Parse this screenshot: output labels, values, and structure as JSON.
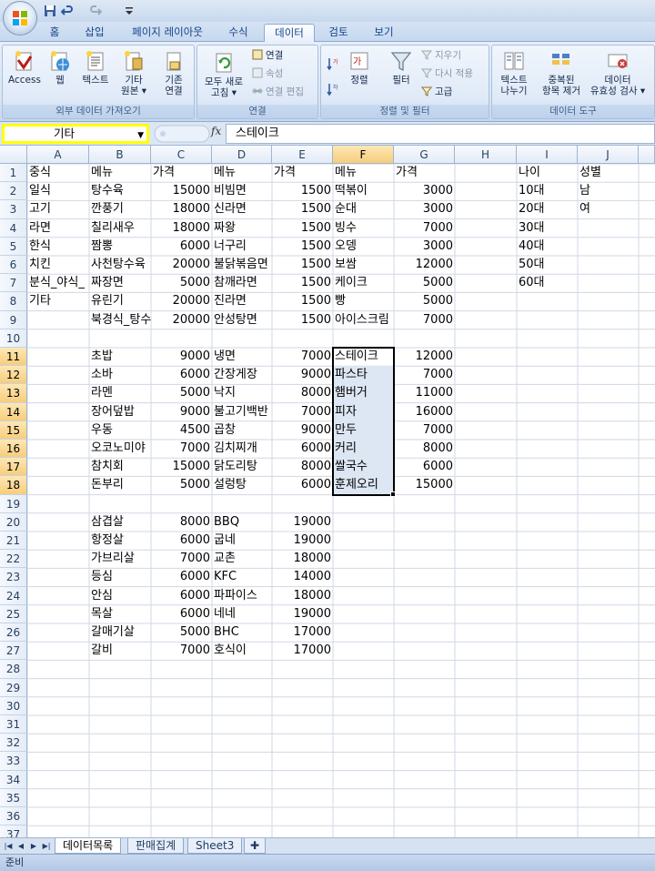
{
  "app": {
    "accent": "#15428b",
    "name_box_highlight": "#ffff00"
  },
  "quick_access": [
    {
      "icon": "save-icon"
    },
    {
      "icon": "undo-icon"
    },
    {
      "icon": "redo-icon"
    },
    {
      "icon": "customize-qat-icon"
    }
  ],
  "ribbon_tabs": [
    "홈",
    "삽입",
    "페이지 레이아웃",
    "수식",
    "데이터",
    "검토",
    "보기"
  ],
  "active_tab": "데이터",
  "ribbon": {
    "external": {
      "label": "외부 데이터 가져오기",
      "access": "Access",
      "web": "웹",
      "text": "텍스트",
      "other_1": "기타",
      "other_2": "원본",
      "existing_1": "기존",
      "existing_2": "연결"
    },
    "connections": {
      "label": "연결",
      "refresh_1": "모두 새로",
      "refresh_2": "고침",
      "connections": "연결",
      "properties": "속성",
      "edit_links": "연결 편집"
    },
    "sort_filter": {
      "label": "정렬 및 필터",
      "sort": "정렬",
      "filter": "필터",
      "clear": "지우기",
      "reapply": "다시 적용",
      "advanced": "고급"
    },
    "data_tools": {
      "label": "데이터 도구",
      "text_to_cols_1": "텍스트",
      "text_to_cols_2": "나누기",
      "remove_dup_1": "중복된",
      "remove_dup_2": "항목 제거",
      "validation_1": "데이터",
      "validation_2": "유효성 검사"
    }
  },
  "formula_bar": {
    "name_box": "기타",
    "fx": "fx",
    "content": "스테이크"
  },
  "grid": {
    "columns": [
      "A",
      "B",
      "C",
      "D",
      "E",
      "F",
      "G",
      "H",
      "I",
      "J"
    ],
    "selected_column": "F",
    "rows": [
      "1",
      "2",
      "3",
      "4",
      "5",
      "6",
      "7",
      "8",
      "9",
      "10",
      "11",
      "12",
      "13",
      "14",
      "15",
      "16",
      "17",
      "18",
      "19",
      "20",
      "21",
      "22",
      "23",
      "24",
      "25",
      "26",
      "27",
      "28",
      "29",
      "30",
      "31",
      "32",
      "33",
      "34",
      "35",
      "36",
      "37"
    ],
    "selected_rows": [
      "11",
      "12",
      "13",
      "14",
      "15",
      "16",
      "17",
      "18"
    ],
    "cells": [
      {
        "r": 1,
        "c": "A",
        "v": "중식"
      },
      {
        "r": 1,
        "c": "B",
        "v": "메뉴"
      },
      {
        "r": 1,
        "c": "C",
        "v": "가격"
      },
      {
        "r": 1,
        "c": "D",
        "v": "메뉴"
      },
      {
        "r": 1,
        "c": "E",
        "v": "가격"
      },
      {
        "r": 1,
        "c": "F",
        "v": "메뉴"
      },
      {
        "r": 1,
        "c": "G",
        "v": "가격"
      },
      {
        "r": 1,
        "c": "I",
        "v": "나이"
      },
      {
        "r": 1,
        "c": "J",
        "v": "성별"
      },
      {
        "r": 2,
        "c": "A",
        "v": "일식"
      },
      {
        "r": 2,
        "c": "B",
        "v": "탕수육"
      },
      {
        "r": 2,
        "c": "C",
        "v": "15000",
        "n": 1
      },
      {
        "r": 2,
        "c": "D",
        "v": "비빔면"
      },
      {
        "r": 2,
        "c": "E",
        "v": "1500",
        "n": 1
      },
      {
        "r": 2,
        "c": "F",
        "v": "떡볶이"
      },
      {
        "r": 2,
        "c": "G",
        "v": "3000",
        "n": 1
      },
      {
        "r": 2,
        "c": "I",
        "v": "10대"
      },
      {
        "r": 2,
        "c": "J",
        "v": "남"
      },
      {
        "r": 3,
        "c": "A",
        "v": "고기"
      },
      {
        "r": 3,
        "c": "B",
        "v": "깐풍기"
      },
      {
        "r": 3,
        "c": "C",
        "v": "18000",
        "n": 1
      },
      {
        "r": 3,
        "c": "D",
        "v": "신라면"
      },
      {
        "r": 3,
        "c": "E",
        "v": "1500",
        "n": 1
      },
      {
        "r": 3,
        "c": "F",
        "v": "순대"
      },
      {
        "r": 3,
        "c": "G",
        "v": "3000",
        "n": 1
      },
      {
        "r": 3,
        "c": "I",
        "v": "20대"
      },
      {
        "r": 3,
        "c": "J",
        "v": "여"
      },
      {
        "r": 4,
        "c": "A",
        "v": "라면"
      },
      {
        "r": 4,
        "c": "B",
        "v": "칠리새우"
      },
      {
        "r": 4,
        "c": "C",
        "v": "18000",
        "n": 1
      },
      {
        "r": 4,
        "c": "D",
        "v": "짜왕"
      },
      {
        "r": 4,
        "c": "E",
        "v": "1500",
        "n": 1
      },
      {
        "r": 4,
        "c": "F",
        "v": "빙수"
      },
      {
        "r": 4,
        "c": "G",
        "v": "7000",
        "n": 1
      },
      {
        "r": 4,
        "c": "I",
        "v": "30대"
      },
      {
        "r": 5,
        "c": "A",
        "v": "한식"
      },
      {
        "r": 5,
        "c": "B",
        "v": "짬뽕"
      },
      {
        "r": 5,
        "c": "C",
        "v": "6000",
        "n": 1
      },
      {
        "r": 5,
        "c": "D",
        "v": "너구리"
      },
      {
        "r": 5,
        "c": "E",
        "v": "1500",
        "n": 1
      },
      {
        "r": 5,
        "c": "F",
        "v": "오뎅"
      },
      {
        "r": 5,
        "c": "G",
        "v": "3000",
        "n": 1
      },
      {
        "r": 5,
        "c": "I",
        "v": "40대"
      },
      {
        "r": 6,
        "c": "A",
        "v": "치킨"
      },
      {
        "r": 6,
        "c": "B",
        "v": "사천탕수육"
      },
      {
        "r": 6,
        "c": "C",
        "v": "20000",
        "n": 1
      },
      {
        "r": 6,
        "c": "D",
        "v": "불닭볶음면"
      },
      {
        "r": 6,
        "c": "E",
        "v": "1500",
        "n": 1
      },
      {
        "r": 6,
        "c": "F",
        "v": "보쌈"
      },
      {
        "r": 6,
        "c": "G",
        "v": "12000",
        "n": 1
      },
      {
        "r": 6,
        "c": "I",
        "v": "50대"
      },
      {
        "r": 7,
        "c": "A",
        "v": "분식_야식_"
      },
      {
        "r": 7,
        "c": "B",
        "v": "짜장면"
      },
      {
        "r": 7,
        "c": "C",
        "v": "5000",
        "n": 1
      },
      {
        "r": 7,
        "c": "D",
        "v": "참깨라면"
      },
      {
        "r": 7,
        "c": "E",
        "v": "1500",
        "n": 1
      },
      {
        "r": 7,
        "c": "F",
        "v": "케이크"
      },
      {
        "r": 7,
        "c": "G",
        "v": "5000",
        "n": 1
      },
      {
        "r": 7,
        "c": "I",
        "v": "60대"
      },
      {
        "r": 8,
        "c": "A",
        "v": "기타"
      },
      {
        "r": 8,
        "c": "B",
        "v": "유린기"
      },
      {
        "r": 8,
        "c": "C",
        "v": "20000",
        "n": 1
      },
      {
        "r": 8,
        "c": "D",
        "v": "진라면"
      },
      {
        "r": 8,
        "c": "E",
        "v": "1500",
        "n": 1
      },
      {
        "r": 8,
        "c": "F",
        "v": "빵"
      },
      {
        "r": 8,
        "c": "G",
        "v": "5000",
        "n": 1
      },
      {
        "r": 9,
        "c": "B",
        "v": "북경식_탕수"
      },
      {
        "r": 9,
        "c": "C",
        "v": "20000",
        "n": 1
      },
      {
        "r": 9,
        "c": "D",
        "v": "안성탕면"
      },
      {
        "r": 9,
        "c": "E",
        "v": "1500",
        "n": 1
      },
      {
        "r": 9,
        "c": "F",
        "v": "아이스크림"
      },
      {
        "r": 9,
        "c": "G",
        "v": "7000",
        "n": 1
      },
      {
        "r": 11,
        "c": "B",
        "v": "초밥"
      },
      {
        "r": 11,
        "c": "C",
        "v": "9000",
        "n": 1
      },
      {
        "r": 11,
        "c": "D",
        "v": "냉면"
      },
      {
        "r": 11,
        "c": "E",
        "v": "7000",
        "n": 1
      },
      {
        "r": 11,
        "c": "F",
        "v": "스테이크"
      },
      {
        "r": 11,
        "c": "G",
        "v": "12000",
        "n": 1
      },
      {
        "r": 12,
        "c": "B",
        "v": "소바"
      },
      {
        "r": 12,
        "c": "C",
        "v": "6000",
        "n": 1
      },
      {
        "r": 12,
        "c": "D",
        "v": "간장게장"
      },
      {
        "r": 12,
        "c": "E",
        "v": "9000",
        "n": 1
      },
      {
        "r": 12,
        "c": "F",
        "v": "파스타"
      },
      {
        "r": 12,
        "c": "G",
        "v": "7000",
        "n": 1
      },
      {
        "r": 13,
        "c": "B",
        "v": "라멘"
      },
      {
        "r": 13,
        "c": "C",
        "v": "5000",
        "n": 1
      },
      {
        "r": 13,
        "c": "D",
        "v": "낙지"
      },
      {
        "r": 13,
        "c": "E",
        "v": "8000",
        "n": 1
      },
      {
        "r": 13,
        "c": "F",
        "v": "햄버거"
      },
      {
        "r": 13,
        "c": "G",
        "v": "11000",
        "n": 1
      },
      {
        "r": 14,
        "c": "B",
        "v": "장어덮밥"
      },
      {
        "r": 14,
        "c": "C",
        "v": "9000",
        "n": 1
      },
      {
        "r": 14,
        "c": "D",
        "v": "불고기백반"
      },
      {
        "r": 14,
        "c": "E",
        "v": "7000",
        "n": 1
      },
      {
        "r": 14,
        "c": "F",
        "v": "피자"
      },
      {
        "r": 14,
        "c": "G",
        "v": "16000",
        "n": 1
      },
      {
        "r": 15,
        "c": "B",
        "v": "우동"
      },
      {
        "r": 15,
        "c": "C",
        "v": "4500",
        "n": 1
      },
      {
        "r": 15,
        "c": "D",
        "v": "곱창"
      },
      {
        "r": 15,
        "c": "E",
        "v": "9000",
        "n": 1
      },
      {
        "r": 15,
        "c": "F",
        "v": "만두"
      },
      {
        "r": 15,
        "c": "G",
        "v": "7000",
        "n": 1
      },
      {
        "r": 16,
        "c": "B",
        "v": "오코노미야"
      },
      {
        "r": 16,
        "c": "C",
        "v": "7000",
        "n": 1
      },
      {
        "r": 16,
        "c": "D",
        "v": "김치찌개"
      },
      {
        "r": 16,
        "c": "E",
        "v": "6000",
        "n": 1
      },
      {
        "r": 16,
        "c": "F",
        "v": "커리"
      },
      {
        "r": 16,
        "c": "G",
        "v": "8000",
        "n": 1
      },
      {
        "r": 17,
        "c": "B",
        "v": "참치회"
      },
      {
        "r": 17,
        "c": "C",
        "v": "15000",
        "n": 1
      },
      {
        "r": 17,
        "c": "D",
        "v": "닭도리탕"
      },
      {
        "r": 17,
        "c": "E",
        "v": "8000",
        "n": 1
      },
      {
        "r": 17,
        "c": "F",
        "v": "쌀국수"
      },
      {
        "r": 17,
        "c": "G",
        "v": "6000",
        "n": 1
      },
      {
        "r": 18,
        "c": "B",
        "v": "돈부리"
      },
      {
        "r": 18,
        "c": "C",
        "v": "5000",
        "n": 1
      },
      {
        "r": 18,
        "c": "D",
        "v": "설렁탕"
      },
      {
        "r": 18,
        "c": "E",
        "v": "6000",
        "n": 1
      },
      {
        "r": 18,
        "c": "F",
        "v": "훈제오리"
      },
      {
        "r": 18,
        "c": "G",
        "v": "15000",
        "n": 1
      },
      {
        "r": 20,
        "c": "B",
        "v": "삼겹살"
      },
      {
        "r": 20,
        "c": "C",
        "v": "8000",
        "n": 1
      },
      {
        "r": 20,
        "c": "D",
        "v": "BBQ"
      },
      {
        "r": 20,
        "c": "E",
        "v": "19000",
        "n": 1
      },
      {
        "r": 21,
        "c": "B",
        "v": "항정살"
      },
      {
        "r": 21,
        "c": "C",
        "v": "6000",
        "n": 1
      },
      {
        "r": 21,
        "c": "D",
        "v": "굽네"
      },
      {
        "r": 21,
        "c": "E",
        "v": "19000",
        "n": 1
      },
      {
        "r": 22,
        "c": "B",
        "v": "가브리살"
      },
      {
        "r": 22,
        "c": "C",
        "v": "7000",
        "n": 1
      },
      {
        "r": 22,
        "c": "D",
        "v": "교촌"
      },
      {
        "r": 22,
        "c": "E",
        "v": "18000",
        "n": 1
      },
      {
        "r": 23,
        "c": "B",
        "v": "등심"
      },
      {
        "r": 23,
        "c": "C",
        "v": "6000",
        "n": 1
      },
      {
        "r": 23,
        "c": "D",
        "v": "KFC"
      },
      {
        "r": 23,
        "c": "E",
        "v": "14000",
        "n": 1
      },
      {
        "r": 24,
        "c": "B",
        "v": "안심"
      },
      {
        "r": 24,
        "c": "C",
        "v": "6000",
        "n": 1
      },
      {
        "r": 24,
        "c": "D",
        "v": "파파이스"
      },
      {
        "r": 24,
        "c": "E",
        "v": "18000",
        "n": 1
      },
      {
        "r": 25,
        "c": "B",
        "v": "목살"
      },
      {
        "r": 25,
        "c": "C",
        "v": "6000",
        "n": 1
      },
      {
        "r": 25,
        "c": "D",
        "v": "네네"
      },
      {
        "r": 25,
        "c": "E",
        "v": "19000",
        "n": 1
      },
      {
        "r": 26,
        "c": "B",
        "v": "갈매기살"
      },
      {
        "r": 26,
        "c": "C",
        "v": "5000",
        "n": 1
      },
      {
        "r": 26,
        "c": "D",
        "v": "BHC"
      },
      {
        "r": 26,
        "c": "E",
        "v": "17000",
        "n": 1
      },
      {
        "r": 27,
        "c": "B",
        "v": "갈비"
      },
      {
        "r": 27,
        "c": "C",
        "v": "7000",
        "n": 1
      },
      {
        "r": 27,
        "c": "D",
        "v": "호식이"
      },
      {
        "r": 27,
        "c": "E",
        "v": "17000",
        "n": 1
      }
    ]
  },
  "sheet_tabs": [
    "데이터목록",
    "판매집계",
    "Sheet3"
  ],
  "active_sheet": "데이터목록",
  "status_bar": {
    "text": "준비"
  }
}
